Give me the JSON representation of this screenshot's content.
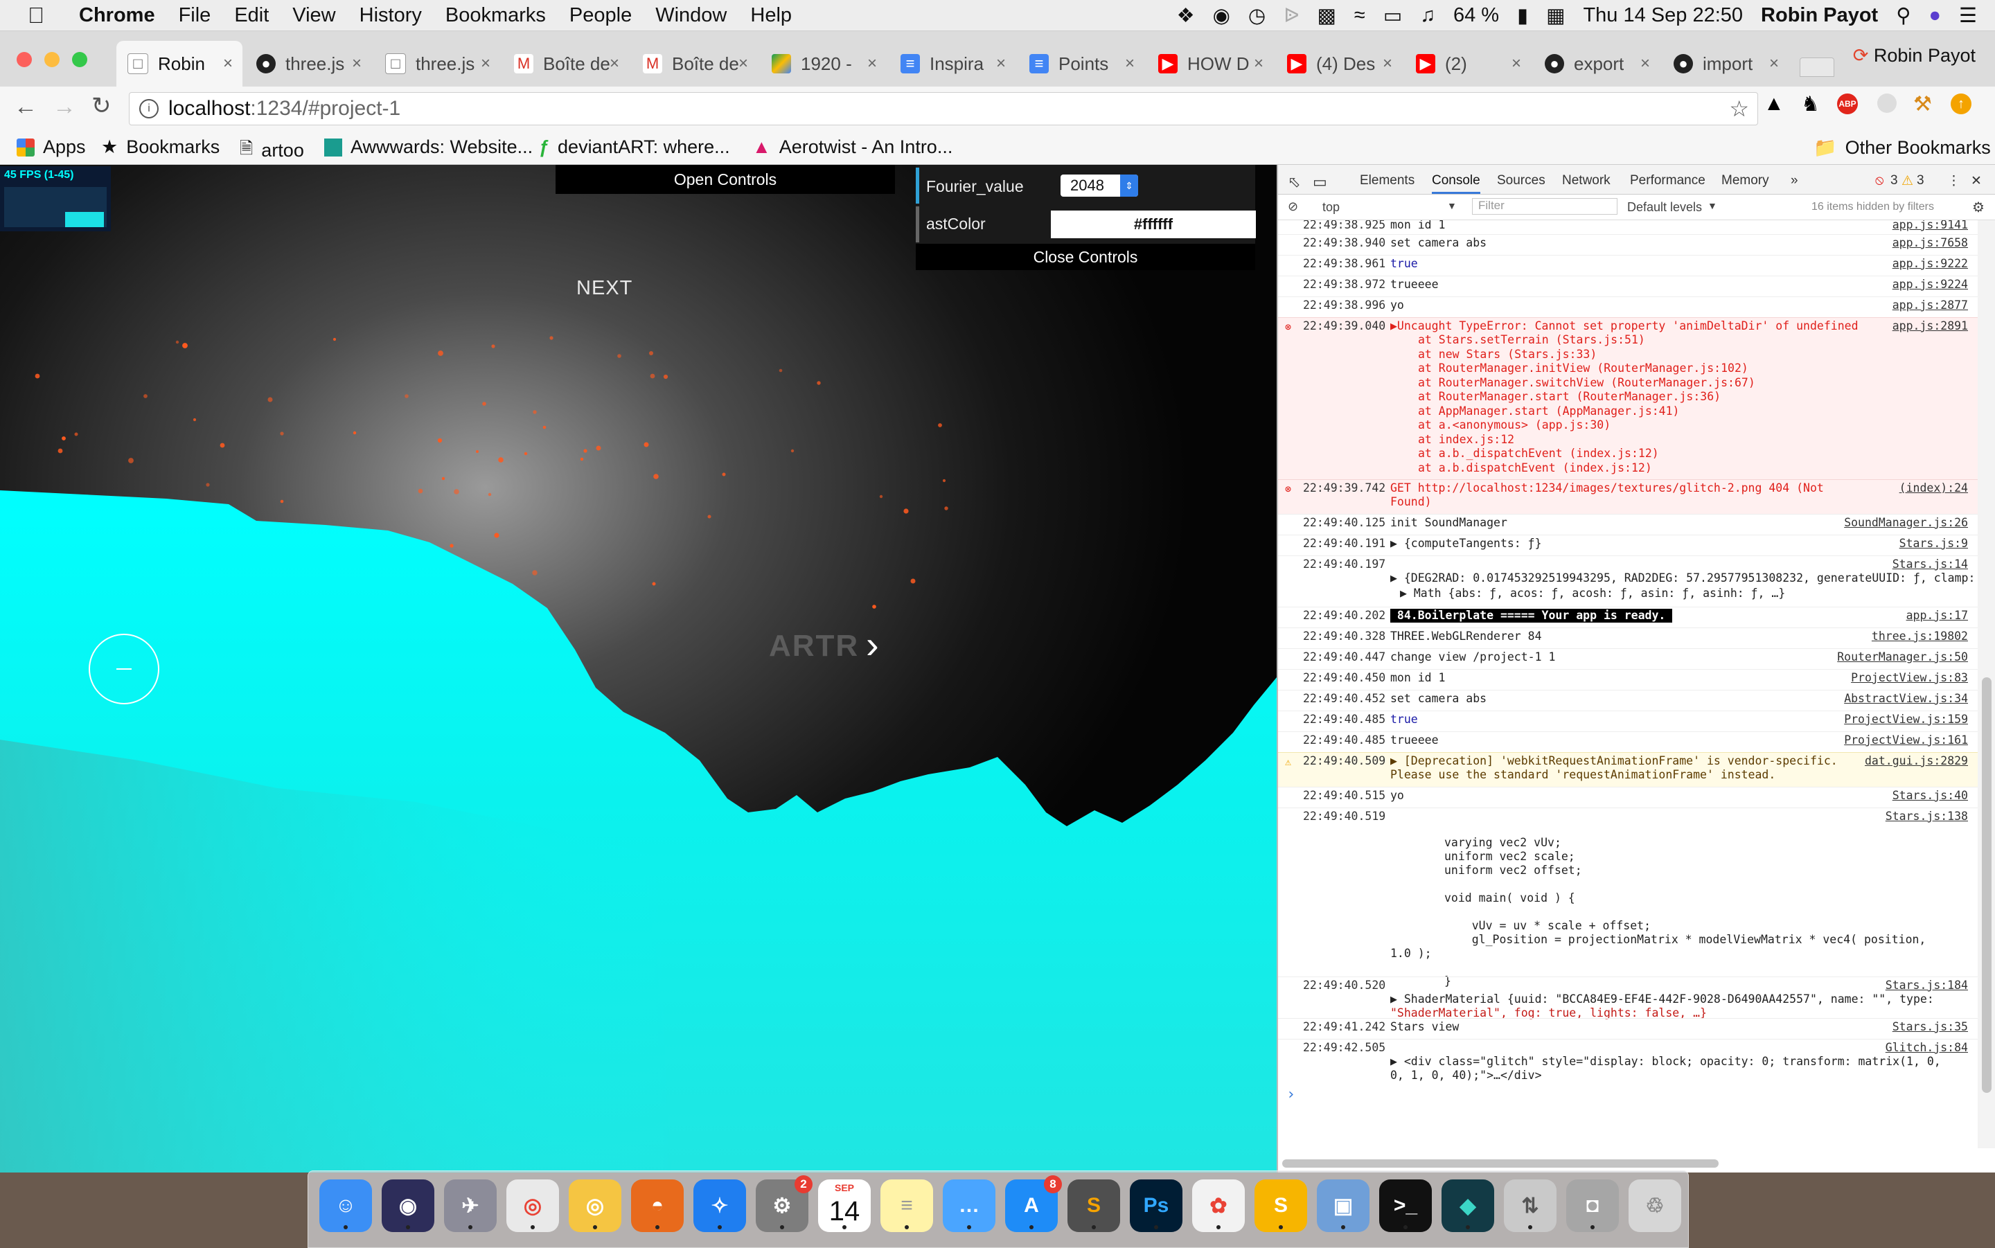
{
  "menubar": {
    "app_name": "Chrome",
    "menus": [
      "File",
      "Edit",
      "View",
      "History",
      "Bookmarks",
      "People",
      "Window",
      "Help"
    ],
    "battery": "64 %",
    "datetime": "Thu 14 Sep  22:50",
    "user": "Robin Payot"
  },
  "tabs": [
    {
      "label": "Robin",
      "icon": "page-icon",
      "active": true
    },
    {
      "label": "three.js",
      "icon": "github-icon"
    },
    {
      "label": "three.js",
      "icon": "page-icon"
    },
    {
      "label": "Boîte de",
      "icon": "gmail-icon"
    },
    {
      "label": "Boîte de",
      "icon": "gmail-icon"
    },
    {
      "label": "1920 -",
      "icon": "drive-icon"
    },
    {
      "label": "Inspira",
      "icon": "docs-icon"
    },
    {
      "label": "Points",
      "icon": "docs-icon"
    },
    {
      "label": "HOW D",
      "icon": "youtube-icon"
    },
    {
      "label": "(4) Des",
      "icon": "youtube-icon"
    },
    {
      "label": "(2)",
      "icon": "youtube-icon"
    },
    {
      "label": "export",
      "icon": "github-icon"
    },
    {
      "label": "import",
      "icon": "github-icon"
    }
  ],
  "profile_name": "Robin Payot",
  "address": {
    "host": "localhost",
    "rest": ":1234/#project-1"
  },
  "bookmarks": [
    "Apps",
    "Bookmarks",
    "artoo",
    "Awwwards: Website...",
    "deviantART: where...",
    "Aerotwist - An Intro..."
  ],
  "other_bookmarks": "Other Bookmarks",
  "page": {
    "fps": "45 FPS (1-45)",
    "open_controls": "Open Controls",
    "close_controls": "Close Controls",
    "controls": [
      {
        "label": "Fourier_value",
        "value": "2048"
      },
      {
        "label": "astColor",
        "value": "#ffffff"
      }
    ],
    "next_label": "NEXT",
    "glitch_text": "ARTR",
    "colors": {
      "terrain": "#00ffff",
      "particles": "#ff5a1f"
    }
  },
  "devtools": {
    "tabs": [
      "Elements",
      "Console",
      "Sources",
      "Network",
      "Performance",
      "Memory"
    ],
    "active_tab": "Console",
    "errors": "3",
    "warnings": "3",
    "context": "top",
    "filter_placeholder": "Filter",
    "levels": "Default levels",
    "hidden": "16 items hidden by filters",
    "logs": [
      {
        "t": "22:49:38.925",
        "m": "mon id 1",
        "s": "app.js:9141"
      },
      {
        "t": "22:49:38.940",
        "m": "set camera abs",
        "s": "app.js:7658"
      },
      {
        "t": "22:49:38.961",
        "m": "true",
        "s": "app.js:9222"
      },
      {
        "t": "22:49:38.972",
        "m": "trueeee",
        "s": "app.js:9224"
      },
      {
        "t": "22:49:38.996",
        "m": "yo",
        "s": "app.js:2877"
      },
      {
        "t": "22:49:39.040",
        "m": "▶Uncaught TypeError: Cannot set property 'animDeltaDir' of undefined",
        "s": "app.js:2891"
      },
      {
        "t": "22:49:39.742",
        "m": "GET http://localhost:1234/images/textures/glitch-2.png 404 (Not",
        "m2": "Found)",
        "s": "(index):24"
      },
      {
        "t": "22:49:40.125",
        "m": "init SoundManager",
        "s": "SoundManager.js:26"
      },
      {
        "t": "22:49:40.191",
        "m": "▶ {computeTangents: ƒ}",
        "s": "Stars.js:9"
      },
      {
        "t": "22:49:40.197",
        "m": "",
        "s": "Stars.js:14"
      },
      {
        "t": "22:49:40.202",
        "m": " 84.Boilerplate ===== Your app is ready. ",
        "s": "app.js:17"
      },
      {
        "t": "22:49:40.328",
        "m": "THREE.WebGLRenderer 84",
        "s": "three.js:19802"
      },
      {
        "t": "22:49:40.447",
        "m": "change view /project-1 1",
        "s": "RouterManager.js:50"
      },
      {
        "t": "22:49:40.450",
        "m": "mon id 1",
        "s": "ProjectView.js:83"
      },
      {
        "t": "22:49:40.452",
        "m": "set camera abs",
        "s": "AbstractView.js:34"
      },
      {
        "t": "22:49:40.485",
        "m": "true",
        "s": "ProjectView.js:159"
      },
      {
        "t": "22:49:40.485",
        "m": "trueeee",
        "s": "ProjectView.js:161"
      },
      {
        "t": "22:49:40.509",
        "m": "▶ [Deprecation] 'webkitRequestAnimationFrame' is vendor-specific.",
        "m2": "Please use the standard 'requestAnimationFrame' instead.",
        "s": "dat.gui.js:2829"
      },
      {
        "t": "22:49:40.515",
        "m": "yo",
        "s": "Stars.js:40"
      },
      {
        "t": "22:49:40.519",
        "m": "",
        "s": "Stars.js:138"
      },
      {
        "t": "22:49:40.520",
        "m": "",
        "s": "Stars.js:184"
      },
      {
        "t": "22:49:41.242",
        "m": "Stars view",
        "s": "Stars.js:35"
      },
      {
        "t": "22:49:42.505",
        "m": "",
        "s": "Glitch.js:84"
      }
    ],
    "stack": [
      "at Stars.setTerrain (Stars.js:51)",
      "at new Stars (Stars.js:33)",
      "at RouterManager.initView (RouterManager.js:102)",
      "at RouterManager.switchView (RouterManager.js:67)",
      "at RouterManager.start (RouterManager.js:36)",
      "at AppManager.start (AppManager.js:41)",
      "at a.<anonymous> (app.js:30)",
      "at index.js:12",
      "at a.b._dispatchEvent (index.js:12)",
      "at a.b.dispatchEvent (index.js:12)"
    ],
    "math_obj": "▶ {DEG2RAD: 0.017453292519943295, RAD2DEG: 57.29577951308232, generateUUID: ƒ, clamp:",
    "math_obj2": "▶ Math {abs: ƒ, acos: ƒ, acosh: ƒ, asin: ƒ, asinh: ƒ, …}",
    "shader": [
      "varying vec2 vUv;",
      "uniform vec2 scale;",
      "uniform vec2 offset;",
      "",
      "void main( void ) {",
      "",
      "    vUv = uv * scale + offset;",
      "    gl_Position = projectionMatrix * modelViewMatrix * vec4( position,",
      "1.0 );",
      "",
      "}"
    ],
    "shader_obj": "▶ ShaderMaterial {uuid: \"BCCA84E9-EF4E-442F-9028-D6490AA42557\", name: \"\", type:",
    "shader_obj2": "\"ShaderMaterial\", fog: true, lights: false, …}",
    "div_obj": "▶ <div class=\"glitch\" style=\"display: block; opacity: 0; transform: matrix(1, 0,",
    "div_obj2": "0, 1, 0, 40);\">…</div>",
    "prompt": "›"
  },
  "dock": [
    "Finder",
    "Siri",
    "Launchpad",
    "Chrome",
    "Chrome Canary",
    "Firefox",
    "Safari",
    "System Preferences",
    "Calendar",
    "Notes",
    "Messages",
    "App Store",
    "Sublime Text",
    "Photoshop",
    "Photos",
    "Sketch",
    "Preview",
    "Terminal",
    "GitKraken",
    "Transmit",
    "Sequel Pro",
    "Trash"
  ],
  "dock_badges": {
    "System Preferences": "2",
    "App Store": "8"
  },
  "calendar": {
    "month": "SEP",
    "day": "14"
  }
}
